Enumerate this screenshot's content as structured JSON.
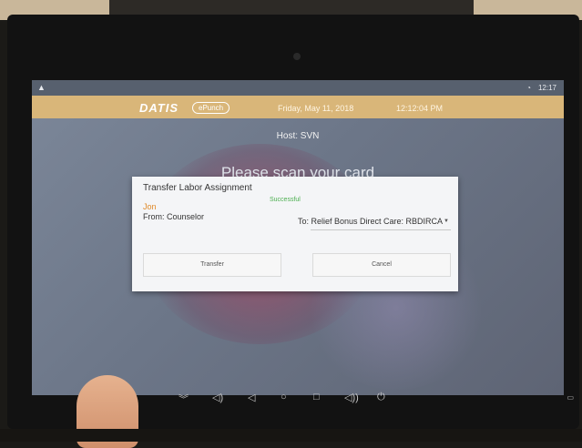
{
  "statusbar": {
    "warning_icon": "warning-triangle-icon",
    "wifi_icon": "wifi-icon",
    "time": "12:17"
  },
  "header": {
    "logo": "DATIS",
    "product": "ePunch",
    "date": "Friday, May 11, 2018",
    "clock": "12:12:04 PM",
    "background_color": "#d9b679"
  },
  "host": "Host: SVN",
  "prompt": "Please scan your card",
  "dialog": {
    "title": "Transfer Labor Assignment",
    "status": "Successful",
    "employee_name": "Jon",
    "from": "From: Counselor",
    "to": "To: Relief Bonus Direct Care: RBDIRCA",
    "transfer_label": "Transfer",
    "cancel_label": "Cancel",
    "status_color": "#4caf50",
    "name_color": "#e08a2a"
  },
  "navbar": {
    "icons": [
      "collapse-icon",
      "volume-down-icon",
      "back-icon",
      "home-icon",
      "recents-icon",
      "volume-up-icon",
      "power-icon",
      "camera-icon"
    ]
  }
}
